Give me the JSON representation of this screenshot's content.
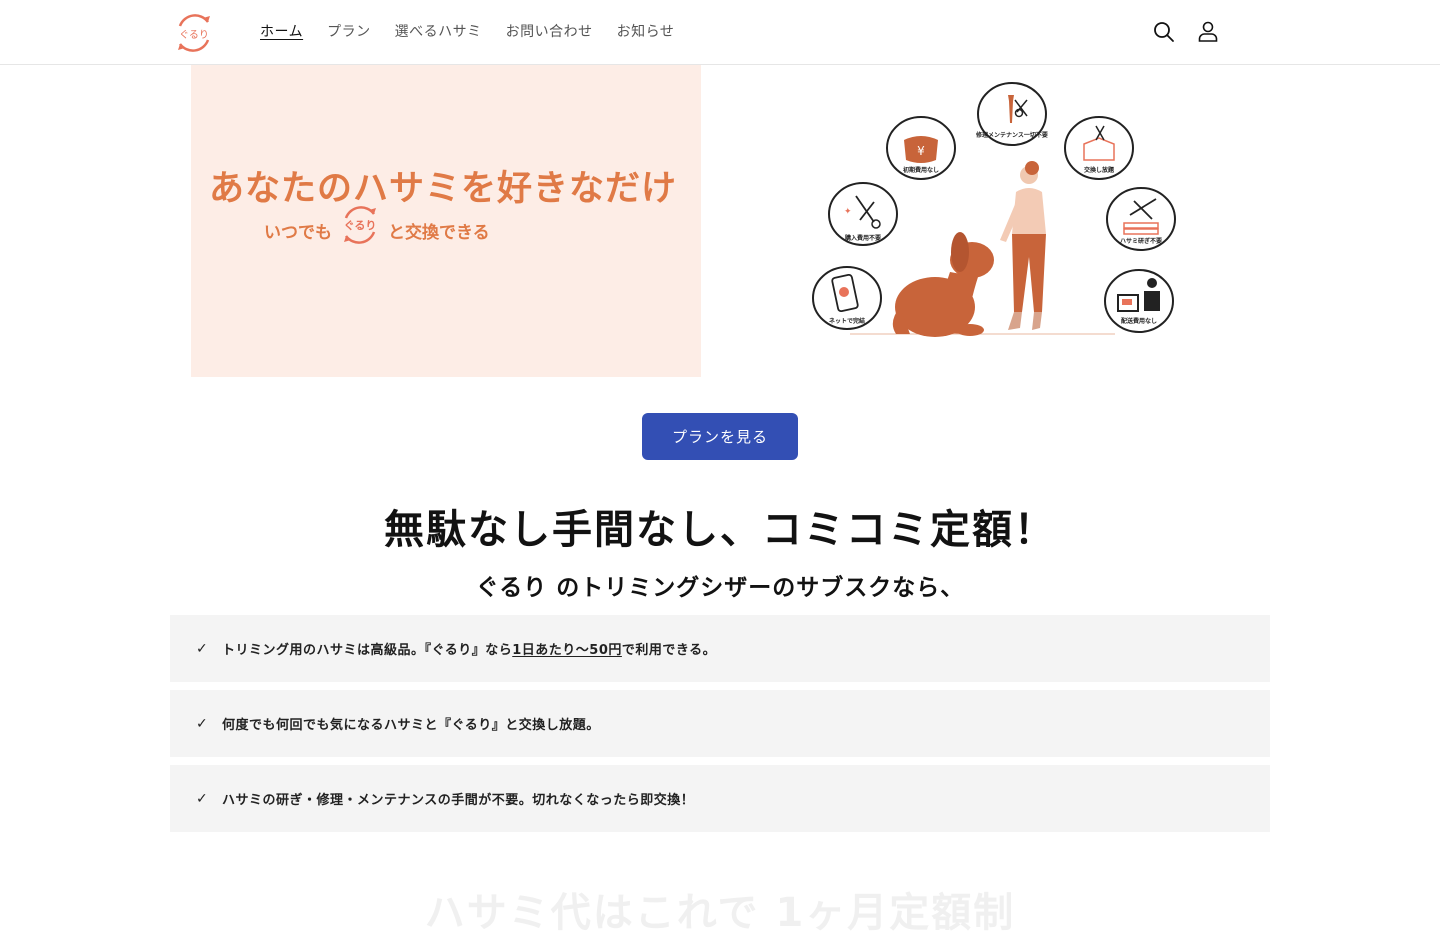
{
  "brand": {
    "logo_text": "ぐるり",
    "accent": "#e8735a",
    "primary": "#334fb4"
  },
  "nav": {
    "items": [
      {
        "label": "ホーム",
        "active": true
      },
      {
        "label": "プラン"
      },
      {
        "label": "選べるハサミ"
      },
      {
        "label": "お問い合わせ"
      },
      {
        "label": "お知らせ"
      }
    ]
  },
  "header_icons": [
    "search-icon",
    "account-icon"
  ],
  "hero": {
    "title": "あなたのハサミを好きなだけ",
    "sub_before": "いつでも",
    "sub_logo": "ぐるり",
    "sub_after": "と交換できる",
    "bubbles": [
      {
        "label": "修理メンテナンス一切不要",
        "icon": "wrench-scissors-icon"
      },
      {
        "label": "初期費用なし",
        "icon": "yen-purse-icon"
      },
      {
        "label": "交換し放題",
        "icon": "box-scissors-icon"
      },
      {
        "label": "購入費用不要",
        "icon": "sparkle-scissors-icon"
      },
      {
        "label": "ハサミ研ぎ不要",
        "icon": "sharpen-scissors-icon"
      },
      {
        "label": "ネットで完結",
        "icon": "phone-icon"
      },
      {
        "label": "配送費用なし",
        "icon": "delivery-icon"
      }
    ]
  },
  "cta": {
    "label": "プランを見る"
  },
  "headline": "無駄なし手間なし、コミコミ定額！",
  "subheadline": "ぐるり のトリミングシザーのサブスクなら、",
  "features": [
    {
      "before": "トリミング用のハサミは高級品。『ぐるり』なら",
      "underline": "1日あたり～50円",
      "after": "で利用できる。"
    },
    {
      "before": "何度でも何回でも気になるハサミと『ぐるり』と交換し放題。",
      "underline": "",
      "after": ""
    },
    {
      "before": "ハサミの研ぎ・修理・メンテナンスの手間が不要。切れなくなったら即交換！",
      "underline": "",
      "after": ""
    }
  ],
  "next_heading": "ハサミ代はこれで 1ヶ月定額制"
}
